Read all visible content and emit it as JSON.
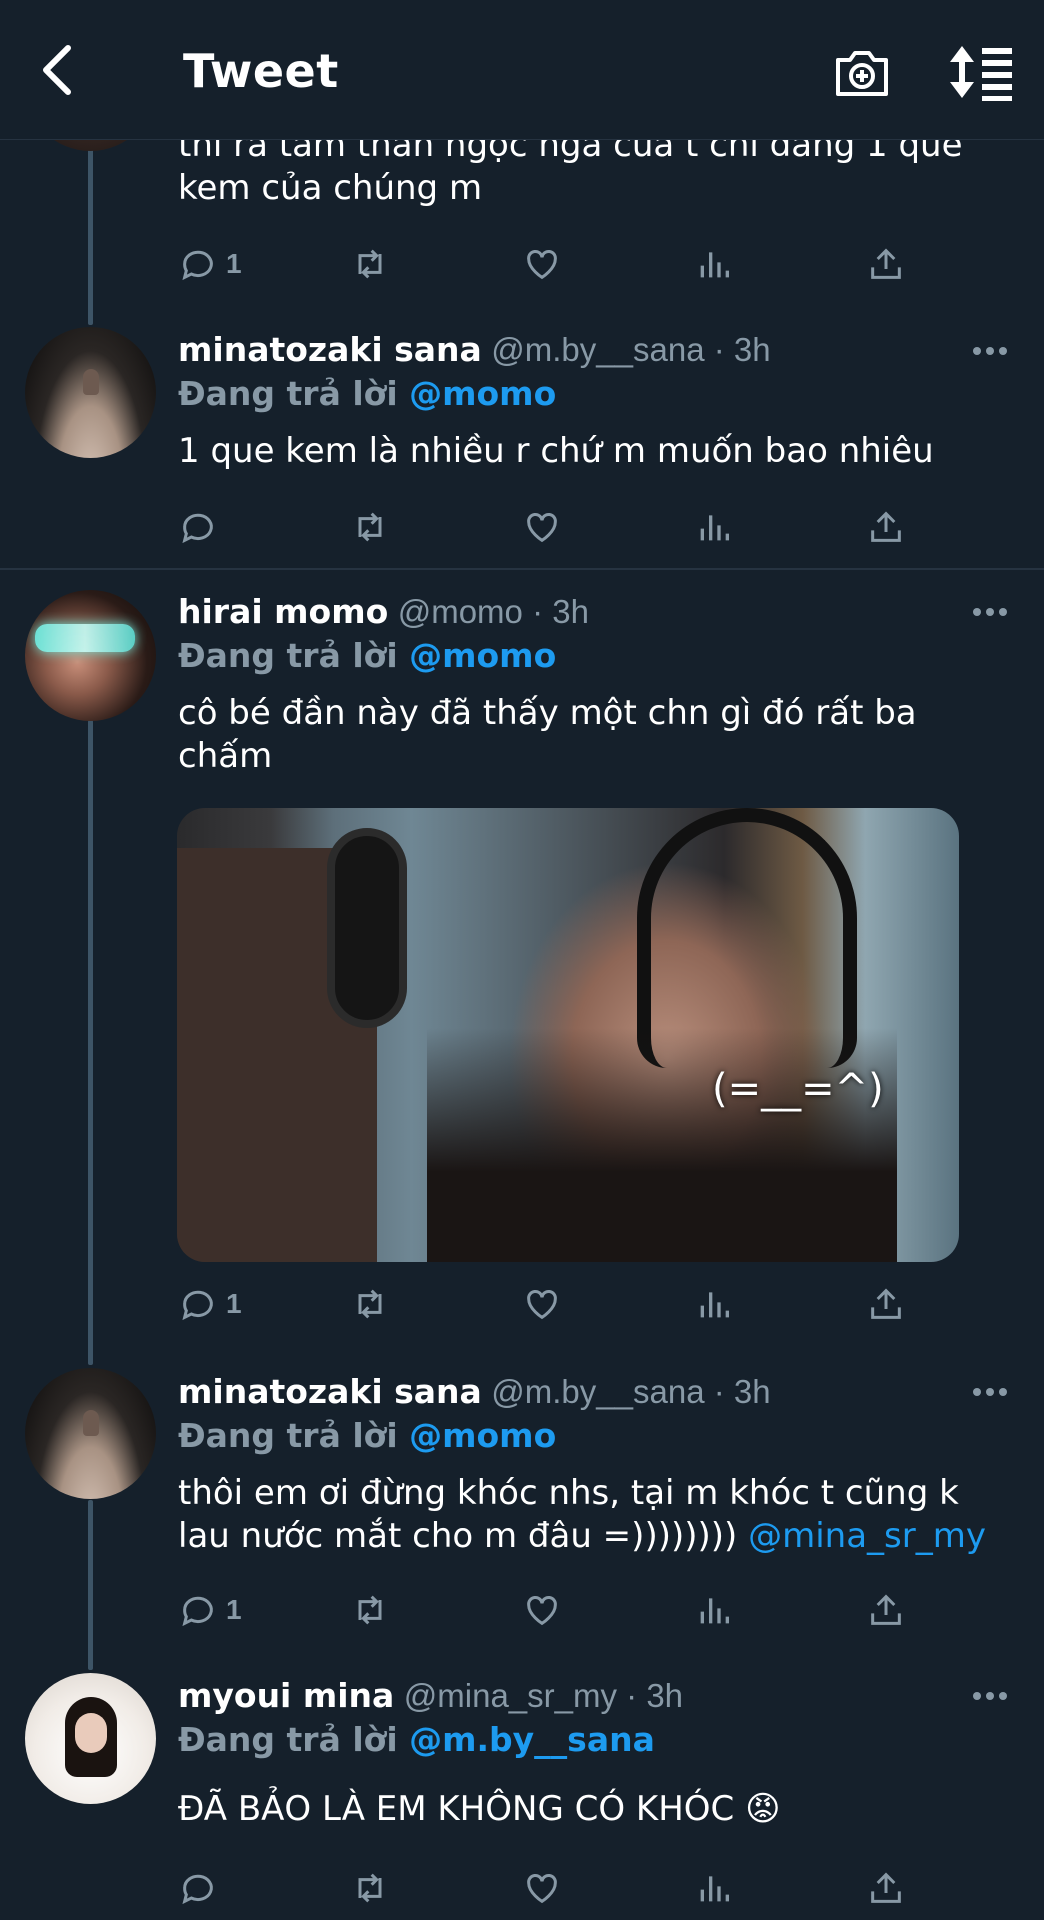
{
  "header": {
    "title": "Tweet"
  },
  "colors": {
    "background": "#15202b",
    "accent": "#1d9bf0",
    "secondary_text": "#8899a6"
  },
  "top_tweet": {
    "text": "thì ra tâm thân ngọc ngà của t chỉ đáng 1 que kem của chúng m",
    "reply_count": "1"
  },
  "tweets": [
    {
      "name": "minatozaki sana",
      "handle": "@m.by__sana · 3h",
      "replying_label": "Đang trả lời ",
      "replying_to": "@momo",
      "text": "1 que kem là nhiều r chứ m muốn bao nhiêu",
      "reply_count": ""
    },
    {
      "name": "hirai momo",
      "handle": "@momo · 3h",
      "replying_label": "Đang trả lời ",
      "replying_to": "@momo",
      "text": "cô bé đần này đã thấy một chn gì đó rất ba chấm",
      "media_caption": "(=__=^)",
      "reply_count": "1"
    },
    {
      "name": "minatozaki sana",
      "handle": "@m.by__sana · 3h",
      "replying_label": "Đang trả lời ",
      "replying_to": "@momo",
      "text": "thôi em ơi đừng khóc nhs, tại m khóc t cũng k lau nước mắt cho m đâu =)))))))) ",
      "text_link": "@mina_sr_my",
      "reply_count": "1"
    },
    {
      "name": "myoui mina",
      "handle": "@mina_sr_my · 3h",
      "replying_label": "Đang trả lời ",
      "replying_to": "@m.by__sana",
      "text": "ĐÃ BẢO LÀ EM KHÔNG CÓ KHÓC 😡",
      "reply_count": ""
    }
  ],
  "icons": [
    "back-arrow-icon",
    "camera-plus-icon",
    "sort-icon",
    "more-icon",
    "reply-icon",
    "retweet-icon",
    "like-icon",
    "stats-icon",
    "share-icon"
  ]
}
